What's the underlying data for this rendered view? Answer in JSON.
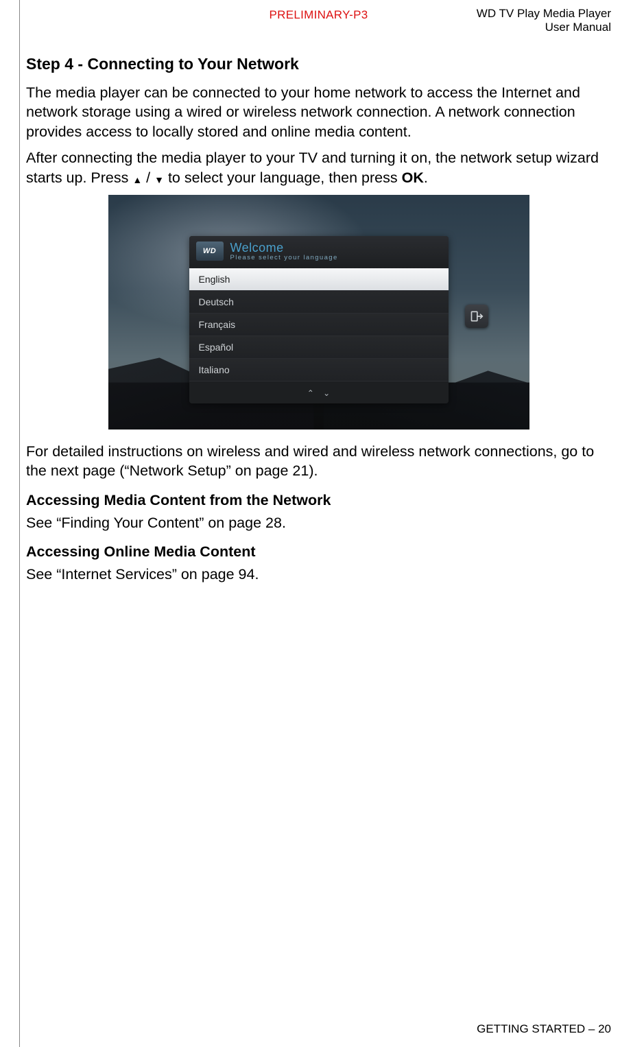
{
  "header": {
    "preliminary": "PRELIMINARY-P3",
    "doc_title_line1": "WD TV Play Media Player",
    "doc_title_line2": "User Manual"
  },
  "step": {
    "heading": "Step 4 - Connecting to Your Network",
    "para1": "The media player can be connected to your home network to access the Internet and network storage using a wired or wireless network connection. A network connection provides access to locally stored and online media content.",
    "para2_a": "After connecting the media player to your TV and turning it on, the network setup wizard starts up. Press ",
    "para2_b": " / ",
    "para2_c": " to select your language, then press ",
    "para2_ok": "OK",
    "para2_end": "."
  },
  "screenshot": {
    "wd_logo": "WD",
    "welcome_title": "Welcome",
    "welcome_sub": "Please select your language",
    "languages": [
      "English",
      "Deutsch",
      "Français",
      "Español",
      "Italiano"
    ],
    "selected_index": 0
  },
  "after_shot": {
    "para": "For detailed instructions on wireless and wired and wireless network connections, go to the next page (“Network Setup” on page 21)."
  },
  "sections": {
    "accessing_network_heading": "Accessing Media Content from the Network",
    "accessing_network_body": "See “Finding Your Content” on page 28.",
    "accessing_online_heading": "Accessing Online Media Content",
    "accessing_online_body": "See “Internet Services” on page 94."
  },
  "footer": {
    "section": "GETTING STARTED",
    "sep": " – ",
    "page": "20"
  }
}
